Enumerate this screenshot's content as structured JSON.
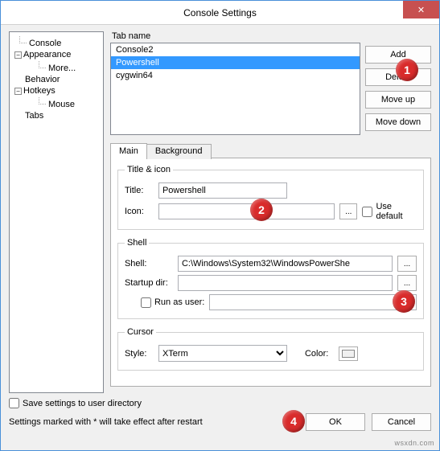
{
  "window": {
    "title": "Console Settings",
    "close": "✕"
  },
  "tree": {
    "items": [
      {
        "label": "Console",
        "depth": 0,
        "expander": ""
      },
      {
        "label": "Appearance",
        "depth": 0,
        "expander": "−"
      },
      {
        "label": "More...",
        "depth": 1,
        "expander": ""
      },
      {
        "label": "Behavior",
        "depth": 0,
        "expander": ""
      },
      {
        "label": "Hotkeys",
        "depth": 0,
        "expander": "−"
      },
      {
        "label": "Mouse",
        "depth": 1,
        "expander": ""
      },
      {
        "label": "Tabs",
        "depth": 0,
        "expander": ""
      }
    ]
  },
  "tabListLabel": "Tab name",
  "tabList": {
    "items": [
      "Console2",
      "Powershell",
      "cygwin64"
    ],
    "selected": 1
  },
  "buttons": {
    "add": "Add",
    "delete": "Delete",
    "moveUp": "Move up",
    "moveDown": "Move down"
  },
  "tabs": {
    "main": "Main",
    "background": "Background"
  },
  "titleIcon": {
    "legend": "Title & icon",
    "titleLabel": "Title:",
    "titleValue": "Powershell",
    "iconLabel": "Icon:",
    "iconValue": "",
    "browse": "...",
    "useDefault": "Use default"
  },
  "shell": {
    "legend": "Shell",
    "shellLabel": "Shell:",
    "shellValue": "C:\\Windows\\System32\\WindowsPowerShe",
    "browse": "...",
    "startupLabel": "Startup dir:",
    "startupValue": "",
    "runAsUser": "Run as user:",
    "runAsUserValue": ""
  },
  "cursor": {
    "legend": "Cursor",
    "styleLabel": "Style:",
    "styleValue": "XTerm",
    "colorLabel": "Color:"
  },
  "bottom": {
    "saveToDir": "Save settings to user directory",
    "note": "Settings marked with * will take effect after restart",
    "ok": "OK",
    "cancel": "Cancel"
  },
  "markers": {
    "1": "1",
    "2": "2",
    "3": "3",
    "4": "4"
  },
  "watermark": "wsxdn.com"
}
